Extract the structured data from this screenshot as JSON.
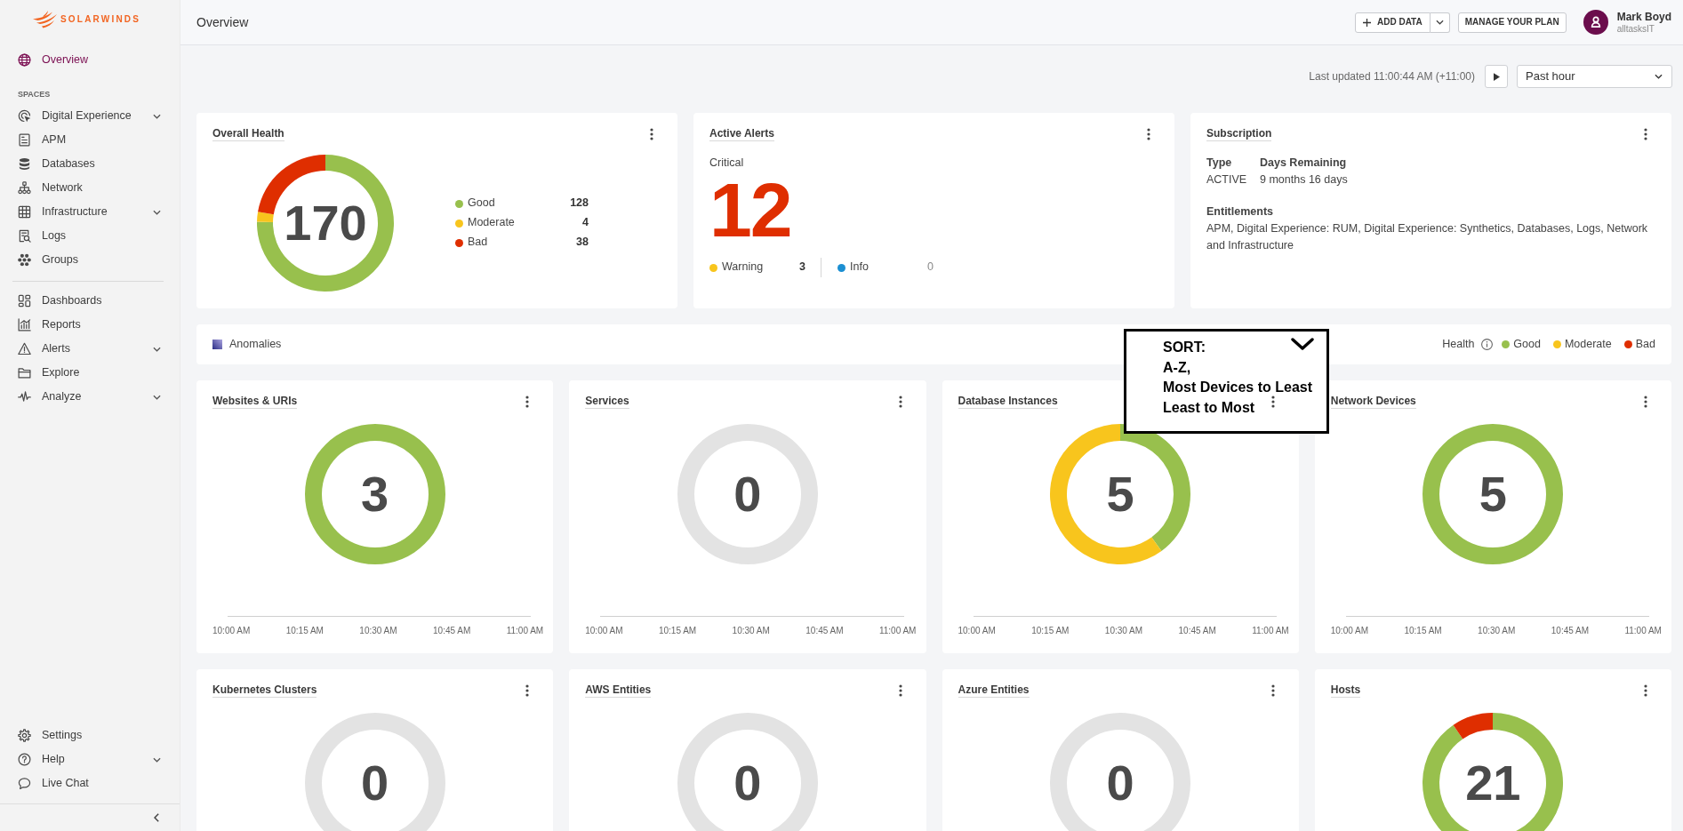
{
  "sidebar": {
    "logo": "SOLARWINDS",
    "primary": [
      {
        "label": "Overview",
        "selected": true,
        "expandable": false
      }
    ],
    "spaces_heading": "SPACES",
    "spaces": [
      {
        "label": "Digital Experience",
        "selected": false,
        "expandable": true
      },
      {
        "label": "APM",
        "selected": false,
        "expandable": false
      },
      {
        "label": "Databases",
        "selected": false,
        "expandable": false
      },
      {
        "label": "Network",
        "selected": false,
        "expandable": false
      },
      {
        "label": "Infrastructure",
        "selected": false,
        "expandable": true
      },
      {
        "label": "Logs",
        "selected": false,
        "expandable": false
      },
      {
        "label": "Groups",
        "selected": false,
        "expandable": false
      }
    ],
    "tools": [
      {
        "label": "Dashboards",
        "selected": false,
        "expandable": false
      },
      {
        "label": "Reports",
        "selected": false,
        "expandable": false
      },
      {
        "label": "Alerts",
        "selected": false,
        "expandable": true
      },
      {
        "label": "Explore",
        "selected": false,
        "expandable": false
      },
      {
        "label": "Analyze",
        "selected": false,
        "expandable": true
      }
    ],
    "footer": [
      {
        "label": "Settings",
        "selected": false,
        "expandable": false
      },
      {
        "label": "Help",
        "selected": false,
        "expandable": true
      },
      {
        "label": "Live Chat",
        "selected": false,
        "expandable": false
      }
    ]
  },
  "header": {
    "title": "Overview",
    "add_data": "ADD DATA",
    "manage_plan": "MANAGE YOUR PLAN",
    "user": {
      "name": "Mark Boyd",
      "org": "alltasksIT"
    }
  },
  "toolbar": {
    "last_updated": "Last updated 11:00:44 AM (+11:00)",
    "time_range": "Past hour"
  },
  "overall_health": {
    "title": "Overall Health",
    "total": "170",
    "legend": [
      {
        "label": "Good",
        "count": "128",
        "color": "#98c04d"
      },
      {
        "label": "Moderate",
        "count": "4",
        "color": "#f8c51d"
      },
      {
        "label": "Bad",
        "count": "38",
        "color": "#df2e00"
      }
    ],
    "chart_data": {
      "type": "donut",
      "values": [
        75.3,
        2.35,
        22.35
      ]
    }
  },
  "active_alerts": {
    "title": "Active Alerts",
    "critical_label": "Critical",
    "critical_count": "12",
    "others": [
      {
        "label": "Warning",
        "count": "3",
        "color": "#f8c51d",
        "dimmed": false
      },
      {
        "label": "Info",
        "count": "0",
        "color": "#1b8fd2",
        "dimmed": true
      }
    ]
  },
  "subscription": {
    "title": "Subscription",
    "fields": [
      {
        "label": "Type",
        "value": "ACTIVE"
      },
      {
        "label": "Days Remaining",
        "value": "9 months 16 days"
      }
    ],
    "entitlements": {
      "label": "Entitlements",
      "text": "APM, Digital Experience: RUM, Digital Experience: Synthetics, Databases, Logs, Network and Infrastructure"
    }
  },
  "anomalies": {
    "label": "Anomalies",
    "legend_heading": "Health",
    "legend": [
      {
        "label": "Good",
        "color": "#98c04d"
      },
      {
        "label": "Moderate",
        "color": "#f8c51d"
      },
      {
        "label": "Bad",
        "color": "#df2e00"
      }
    ]
  },
  "tiles": [
    {
      "title": "Websites & URIs",
      "count": "3",
      "segments": [
        {
          "color": "#98c04d"
        }
      ],
      "axis_labels": [
        "10:00 AM",
        "10:15 AM",
        "10:30 AM",
        "10:45 AM",
        "11:00 AM"
      ]
    },
    {
      "title": "Services",
      "count": "0",
      "axis_labels": [
        "10:00 AM",
        "10:15 AM",
        "10:30 AM",
        "10:45 AM",
        "11:00 AM"
      ]
    },
    {
      "title": "Database Instances",
      "count": "5",
      "segments": [
        {
          "color": "#98c04d"
        },
        {
          "color": "#f8c51d"
        }
      ],
      "chart_data": {
        "type": "donut",
        "values": [
          40,
          60
        ]
      },
      "axis_labels": [
        "10:00 AM",
        "10:15 AM",
        "10:30 AM",
        "10:45 AM",
        "11:00 AM"
      ]
    },
    {
      "title": "Network Devices",
      "count": "5",
      "segments": [
        {
          "color": "#98c04d"
        }
      ],
      "axis_labels": [
        "10:00 AM",
        "10:15 AM",
        "10:30 AM",
        "10:45 AM",
        "11:00 AM"
      ]
    },
    {
      "title": "Kubernetes Clusters",
      "count": "0"
    },
    {
      "title": "AWS Entities",
      "count": "0"
    },
    {
      "title": "Azure Entities",
      "count": "0"
    },
    {
      "title": "Hosts",
      "count": "21",
      "segments": [
        {
          "color": "#98c04d"
        },
        {
          "color": "#df2e00"
        }
      ],
      "chart_data": {
        "type": "donut",
        "values": [
          90.5,
          9.5
        ]
      }
    }
  ],
  "callout": {
    "title": "SORT:",
    "options": [
      "A-Z,",
      "Most Devices to Least",
      "Least to Most"
    ]
  }
}
